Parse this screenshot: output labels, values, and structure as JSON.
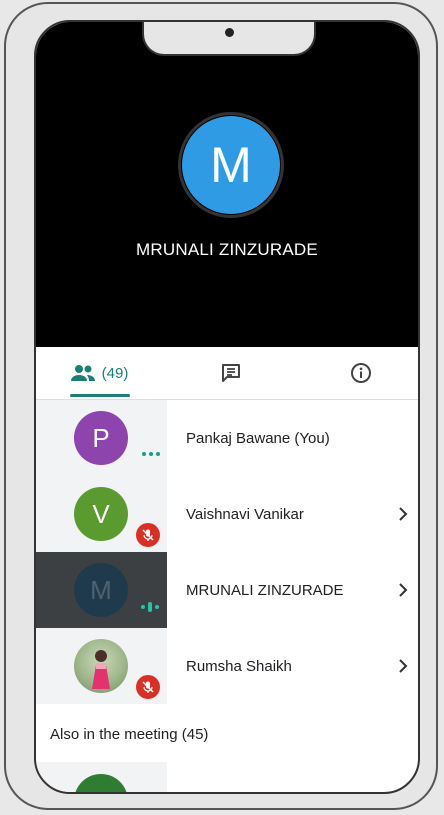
{
  "speaker": {
    "initial": "M",
    "name": "MRUNALI ZINZURADE",
    "avatar_color": "#2f9be5"
  },
  "tabs": {
    "people_count": "(49)",
    "people_icon": "people-icon",
    "chat_icon": "chat-icon",
    "info_icon": "info-icon",
    "accent": "#1a7f74"
  },
  "participants": [
    {
      "initial": "P",
      "name": "Pankaj Bawane (You)",
      "avatar_color": "#8e44ad",
      "status": "more-dots"
    },
    {
      "initial": "V",
      "name": "Vaishnavi Vanikar",
      "avatar_color": "#5b9a2f",
      "status": "muted"
    },
    {
      "initial": "M",
      "name": "MRUNALI ZINZURADE",
      "avatar_color": "#1f3a4d",
      "status": "speaking"
    },
    {
      "initial": "",
      "name": "Rumsha Shaikh",
      "avatar_color": "#b7c9a8",
      "status": "muted"
    }
  ],
  "section": {
    "title": "Also in the meeting (45)"
  }
}
